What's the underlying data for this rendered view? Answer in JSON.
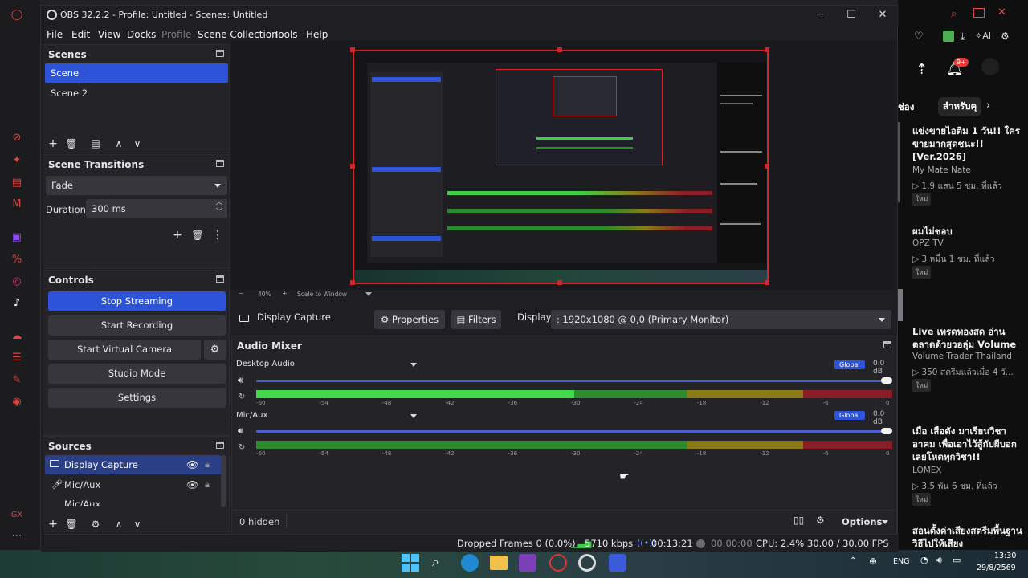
{
  "window": {
    "title": "OBS 32.2.2 - Profile: Untitled - Scenes: Untitled",
    "controls": {
      "minimize": "─",
      "maximize": "☐",
      "close": "✕"
    }
  },
  "menu": [
    "File",
    "Edit",
    "View",
    "Docks",
    "Profile",
    "Scene Collection",
    "Tools",
    "Help"
  ],
  "scenes": {
    "title": "Scenes",
    "items": [
      "Scene",
      "Scene 2"
    ],
    "selected": "Scene"
  },
  "transitions": {
    "title": "Scene Transitions",
    "type": "Fade",
    "duration_label": "Duration",
    "duration_value": "300 ms"
  },
  "controls": {
    "title": "Controls",
    "stop_streaming": "Stop Streaming",
    "start_recording": "Start Recording",
    "start_virtual_camera": "Start Virtual Camera",
    "studio_mode": "Studio Mode",
    "settings": "Settings"
  },
  "sources": {
    "title": "Sources",
    "items": [
      "Display Capture",
      "Mic/Aux",
      "Mic/Aux"
    ]
  },
  "preview_toolbar": {
    "zoom": "40%",
    "scale": "Scale to Window"
  },
  "properties_bar": {
    "source_name": "Display Capture",
    "properties": "Properties",
    "filters": "Filters",
    "display_label": "Display",
    "display_value": ": 1920x1080 @ 0,0 (Primary Monitor)"
  },
  "mixer": {
    "title": "Audio Mixer",
    "channels": [
      {
        "name": "Desktop Audio",
        "badge": "Global",
        "db": "0.0 dB",
        "volume": 1.0,
        "level": 0.5
      },
      {
        "name": "Mic/Aux",
        "badge": "Global",
        "db": "0.0 dB",
        "volume": 1.0,
        "level": 0.0
      }
    ],
    "scale": [
      "-60",
      "-54",
      "-48",
      "-42",
      "-36",
      "-30",
      "-24",
      "-18",
      "-12",
      "-6",
      "0"
    ]
  },
  "footer": {
    "hidden": "0 hidden",
    "options": "Options"
  },
  "status": {
    "dropped": "Dropped Frames 0 (0.0%)",
    "bitrate": "5710 kbps",
    "stream_time": "00:13:21",
    "rec_time": "00:00:00",
    "cpu": "CPU: 2.4%",
    "fps": "30.00 / 30.00 FPS"
  },
  "side_panel": {
    "tabs": [
      "ช่อง",
      "สำหรับคุ"
    ],
    "notif_badge": "9+",
    "items": [
      {
        "title": "แข่งขายไอติม 1 วัน!! ใครขายมากสุดชนะ!! [Ver.2026]",
        "channel": "My Mate Nate",
        "meta": "▷ 1.9 แสน  5 ชม. ที่แล้ว",
        "tag": "ใหม่"
      },
      {
        "title": "ผมไม่ชอบ",
        "channel": "OPZ TV",
        "meta": "▷ 3 หมื่น  1 ชม. ที่แล้ว",
        "tag": "ใหม่"
      },
      {
        "title": "Live เทรดทองสด อ่านตลาดด้วยวอลุ่ม Volume",
        "channel": "Volume Trader Thailand",
        "meta": "▷ 350  สตรีมแล้วเมื่อ 4 วั...",
        "tag": "ใหม่"
      },
      {
        "title": "เมื่อ เสือดัง มาเรียนวิชาอาคม เพื่อเอาไว้สู้กับผีบอกเลยโหดทุกวิชา!!",
        "channel": "LOMEX",
        "meta": "▷ 3.5 พัน  6 ชม. ที่แล้ว",
        "tag": "ใหม่"
      },
      {
        "title": "สอนตั้งค่าเสียงสตรีมพื้นฐานวิธีไปให้เสียง",
        "channel": "",
        "meta": "",
        "tag": ""
      }
    ]
  },
  "tray": {
    "lang": "ENG",
    "time": "13:30",
    "date": "29/8/2569"
  }
}
